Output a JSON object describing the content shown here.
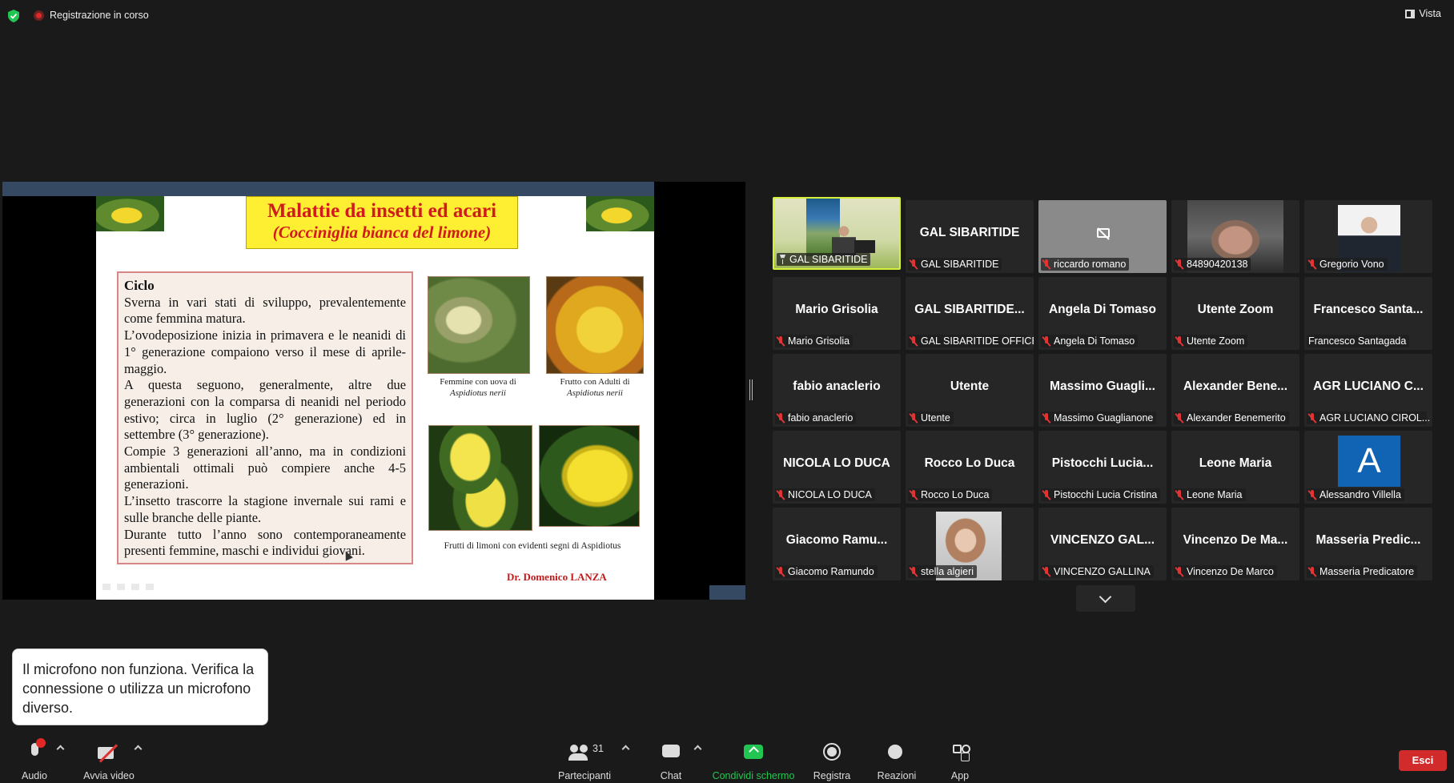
{
  "topbar": {
    "recording_label": "Registrazione in corso",
    "view_label": "Vista"
  },
  "slide": {
    "title_line1": "Malattie da insetti ed acari",
    "title_line2": "(Cocciniglia bianca del limone)",
    "heading": "Ciclo",
    "paragraphs": [
      "Sverna in vari stati di sviluppo, prevalentemente come femmina matura.",
      "L’ovodeposizione inizia in primavera e le neanidi di 1° generazione compaiono verso il mese di aprile-maggio.",
      "A questa seguono, generalmente, altre due generazioni con la comparsa di neanidi nel periodo estivo; circa in luglio (2° generazione) ed in settembre (3° generazione).",
      "Compie 3 generazioni all’anno, ma in condizioni ambientali ottimali può compiere anche 4-5 generazioni.",
      "L’insetto trascorre la stagione invernale sui rami e sulle branche delle piante.",
      "Durante tutto l’anno sono contemporaneamente presenti femmine, maschi e individui giovani."
    ],
    "caption1_line1": "Femmine con uova di",
    "caption1_line2": "Aspidiotus nerii",
    "caption2_line1": "Frutto con Adulti di",
    "caption2_line2": "Aspidiotus nerii",
    "caption3": "Frutti di limoni  con evidenti  segni  di Aspidiotus",
    "author": "Dr. Domenico LANZA"
  },
  "participants_grid": [
    {
      "name": "",
      "label": "GAL SIBARITIDE",
      "video": "gal",
      "pinned": true,
      "active": true
    },
    {
      "name": "GAL SIBARITIDE",
      "label": "GAL SIBARITIDE",
      "muted": true
    },
    {
      "name": "",
      "label": "riccardo romano",
      "video": "grey",
      "muted": true
    },
    {
      "name": "",
      "label": "84890420138",
      "video": "car",
      "muted": true
    },
    {
      "name": "",
      "label": "Gregorio Vono",
      "video": "suit",
      "muted": true
    },
    {
      "name": "Mario Grisolia",
      "label": "Mario Grisolia",
      "muted": true
    },
    {
      "name": "GAL SIBARITIDE...",
      "label": "GAL SIBARITIDE OFFICE",
      "muted": true
    },
    {
      "name": "Angela Di Tomaso",
      "label": "Angela Di Tomaso",
      "muted": true
    },
    {
      "name": "Utente Zoom",
      "label": "Utente Zoom",
      "muted": true
    },
    {
      "name": "Francesco  Santa...",
      "label": "Francesco Santagada",
      "muted": false
    },
    {
      "name": "fabio anaclerio",
      "label": "fabio anaclerio",
      "muted": true
    },
    {
      "name": "Utente",
      "label": "Utente",
      "muted": true
    },
    {
      "name": "Massimo  Guagli...",
      "label": "Massimo Guaglianone",
      "muted": true
    },
    {
      "name": "Alexander  Bene...",
      "label": "Alexander Benemerito",
      "muted": true
    },
    {
      "name": "AGR LUCIANO C...",
      "label": "AGR LUCIANO CIROL...",
      "muted": true
    },
    {
      "name": "NICOLA LO DUCA",
      "label": "NICOLA LO DUCA",
      "muted": true
    },
    {
      "name": "Rocco Lo Duca",
      "label": "Rocco Lo Duca",
      "muted": true
    },
    {
      "name": "Pistocchi  Lucia...",
      "label": "Pistocchi Lucia Cristina",
      "muted": true
    },
    {
      "name": "Leone Maria",
      "label": "Leone Maria",
      "muted": true
    },
    {
      "name": "",
      "label": "Alessandro Villella",
      "video": "avatar-a",
      "avatar_letter": "A",
      "muted": true
    },
    {
      "name": "Giacomo  Ramu...",
      "label": "Giacomo Ramundo",
      "muted": true
    },
    {
      "name": "",
      "label": "stella algieri",
      "video": "stella",
      "muted": true
    },
    {
      "name": "VINCENZO  GAL...",
      "label": "VINCENZO GALLINA",
      "muted": true
    },
    {
      "name": "Vincenzo  De  Ma...",
      "label": "Vincenzo De Marco",
      "muted": true
    },
    {
      "name": "Masseria  Predic...",
      "label": "Masseria Predicatore",
      "muted": true
    }
  ],
  "toast": {
    "message": "Il microfono non funziona. Verifica la connessione o utilizza un microfono diverso."
  },
  "toolbar": {
    "audio_label": "Audio",
    "video_label": "Avvia video",
    "participants_label": "Partecipanti",
    "participants_count": "31",
    "chat_label": "Chat",
    "share_label": "Condividi schermo",
    "record_label": "Registra",
    "reactions_label": "Reazioni",
    "apps_label": "App",
    "leave_label": "Esci"
  },
  "colors": {
    "accent_green": "#23c552",
    "leave_red": "#d12b2b",
    "active_speaker": "#d7f03a"
  }
}
